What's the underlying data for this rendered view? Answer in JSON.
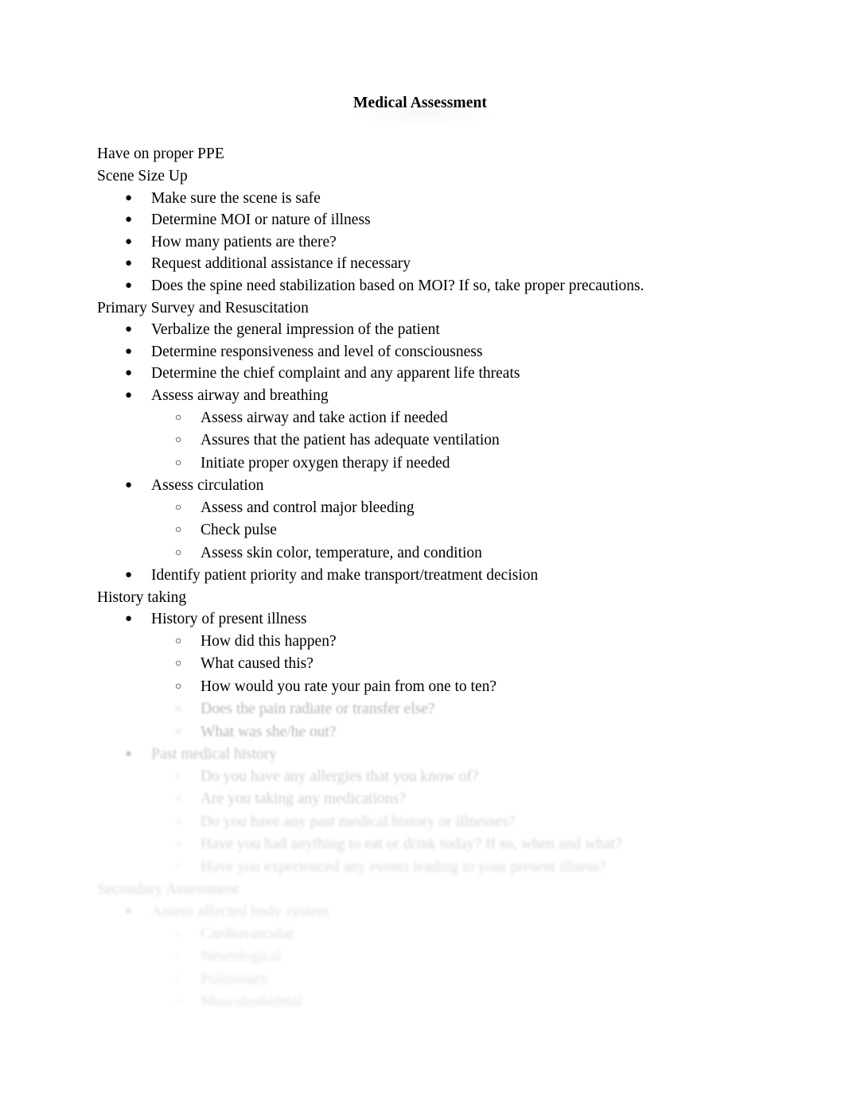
{
  "document": {
    "title": "Medical Assessment"
  },
  "body": [
    {
      "level": 0,
      "text": "Have on proper PPE",
      "faded": false
    },
    {
      "level": 0,
      "text": "Scene Size Up",
      "faded": false
    },
    {
      "level": 1,
      "text": "Make sure the scene is safe",
      "faded": false
    },
    {
      "level": 1,
      "text": "Determine MOI or nature of illness",
      "faded": false
    },
    {
      "level": 1,
      "text": "How many patients are there?",
      "faded": false
    },
    {
      "level": 1,
      "text": "Request additional assistance if necessary",
      "faded": false
    },
    {
      "level": 1,
      "text": "Does the spine need stabilization based on MOI? If so, take proper precautions.",
      "faded": false
    },
    {
      "level": 0,
      "text": "Primary Survey and Resuscitation",
      "faded": false
    },
    {
      "level": 1,
      "text": "Verbalize the general impression of the patient",
      "faded": false
    },
    {
      "level": 1,
      "text": "Determine responsiveness and level of consciousness",
      "faded": false
    },
    {
      "level": 1,
      "text": "Determine the chief complaint and any apparent life threats",
      "faded": false
    },
    {
      "level": 1,
      "text": "Assess airway and breathing",
      "faded": false
    },
    {
      "level": 2,
      "text": "Assess airway and take action if needed",
      "faded": false
    },
    {
      "level": 2,
      "text": "Assures that the patient has adequate ventilation",
      "faded": false
    },
    {
      "level": 2,
      "text": "Initiate proper oxygen therapy if needed",
      "faded": false
    },
    {
      "level": 1,
      "text": "Assess circulation",
      "faded": false
    },
    {
      "level": 2,
      "text": "Assess and control major bleeding",
      "faded": false
    },
    {
      "level": 2,
      "text": "Check pulse",
      "faded": false
    },
    {
      "level": 2,
      "text": "Assess skin color, temperature, and condition",
      "faded": false
    },
    {
      "level": 1,
      "text": "Identify patient priority and make transport/treatment decision",
      "faded": false
    },
    {
      "level": 0,
      "text": "History taking",
      "faded": false
    },
    {
      "level": 1,
      "text": "History of present illness",
      "faded": false
    },
    {
      "level": 2,
      "text": "How did this happen?",
      "faded": false
    },
    {
      "level": 2,
      "text": "What caused this?",
      "faded": false
    },
    {
      "level": 2,
      "text": "How would you rate your pain from one to ten?",
      "faded": false
    },
    {
      "level": 2,
      "text": "Does the pain radiate or transfer else?",
      "faded": true,
      "fade": 1
    },
    {
      "level": 2,
      "text": "What was she/he out?",
      "faded": true,
      "fade": 1
    },
    {
      "level": 1,
      "text": "Past medical history",
      "faded": true,
      "fade": 2
    },
    {
      "level": 2,
      "text": "Do you have any allergies that you know of?",
      "faded": true,
      "fade": 3
    },
    {
      "level": 2,
      "text": "Are you taking any medications?",
      "faded": true,
      "fade": 3
    },
    {
      "level": 2,
      "text": "Do you have any past medical history or illnesses?",
      "faded": true,
      "fade": 4
    },
    {
      "level": 2,
      "text": "Have you had anything to eat or drink today? If so, when and what?",
      "faded": true,
      "fade": 4
    },
    {
      "level": 2,
      "text": "Have you experienced any events leading to your present illness?",
      "faded": true,
      "fade": 5
    },
    {
      "level": 0,
      "text": "Secondary Assessment",
      "faded": true,
      "fade": 5
    },
    {
      "level": 1,
      "text": "Assess affected body system",
      "faded": true,
      "fade": 6
    },
    {
      "level": 2,
      "text": "Cardiovascular",
      "faded": true,
      "fade": 6
    },
    {
      "level": 2,
      "text": "Neurological",
      "faded": true,
      "fade": 7
    },
    {
      "level": 2,
      "text": "Pulmonary",
      "faded": true,
      "fade": 7
    },
    {
      "level": 2,
      "text": "Musculoskeletal",
      "faded": true,
      "fade": 7
    }
  ],
  "bullets": {
    "level1_glyph": "●",
    "level2_glyph": "○"
  }
}
